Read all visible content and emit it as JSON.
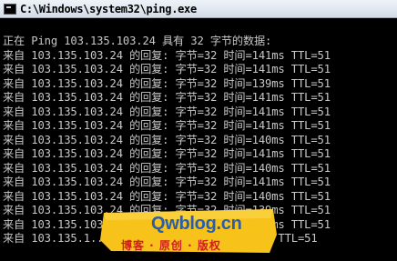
{
  "window": {
    "title": "C:\\Windows\\system32\\ping.exe"
  },
  "console": {
    "lines": [
      "正在 Ping 103.135.103.24 具有 32 字节的数据:",
      "来自 103.135.103.24 的回复: 字节=32 时间=141ms TTL=51",
      "来自 103.135.103.24 的回复: 字节=32 时间=141ms TTL=51",
      "来自 103.135.103.24 的回复: 字节=32 时间=139ms TTL=51",
      "来自 103.135.103.24 的回复: 字节=32 时间=141ms TTL=51",
      "来自 103.135.103.24 的回复: 字节=32 时间=141ms TTL=51",
      "来自 103.135.103.24 的回复: 字节=32 时间=141ms TTL=51",
      "来自 103.135.103.24 的回复: 字节=32 时间=140ms TTL=51",
      "来自 103.135.103.24 的回复: 字节=32 时间=141ms TTL=51",
      "来自 103.135.103.24 的回复: 字节=32 时间=140ms TTL=51",
      "来自 103.135.103.24 的回复: 字节=32 时间=141ms TTL=51",
      "来自 103.135.103.24 的回复: 字节=32 时间=140ms TTL=51",
      "来自 103.135.103.24 的回复: 字节=32 时间=139ms TTL=51",
      "来自 103.135.103.24 的回复: 字节=32 时间=139ms TTL=51",
      "来自 103.135.1... 的回复: 字节=32 时间=139ms TTL=51"
    ]
  },
  "watermark": {
    "domain": "Qwblog.cn",
    "slogan": "博客 · 原创 · 版权"
  },
  "colors": {
    "console_bg": "#000000",
    "console_text": "#c7c7c7",
    "watermark_bg": "#f7c21a",
    "watermark_domain": "#2a5fa8",
    "watermark_slogan": "#d11d1d"
  }
}
